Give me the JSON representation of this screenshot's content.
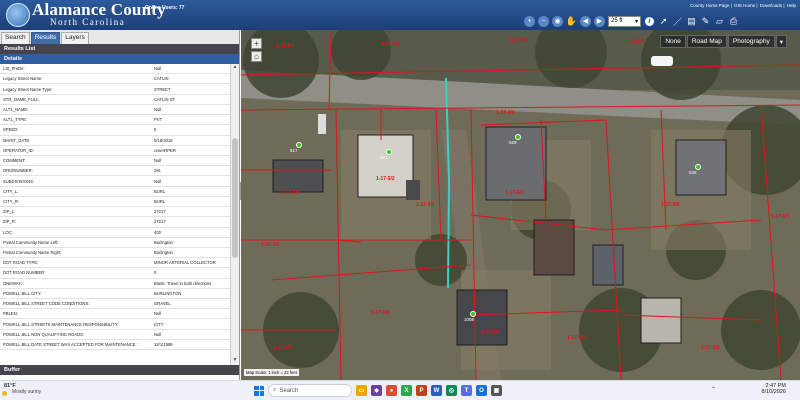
{
  "header": {
    "brand_line1": "Alamance County",
    "brand_line2": "North Carolina",
    "online_users": "Online Users: 77",
    "links": [
      "County Home Page",
      "GIS Home",
      "Downloads",
      "Help"
    ],
    "scale_value": "25 ft",
    "info_label": "i"
  },
  "sidebar": {
    "tabs": [
      "Search",
      "Results",
      "Layers"
    ],
    "active_tab": "Results",
    "results_list_label": "Results List",
    "details_label": "Details",
    "buffer_label": "Buffer",
    "rows": [
      {
        "key": "LSt_PreDir:",
        "value": "Null"
      },
      {
        "key": "Legacy Street Name:",
        "value": "CATLIN"
      },
      {
        "key": "Legacy Street Name Type:",
        "value": "STREET"
      },
      {
        "key": "STR_NAME_FULL:",
        "value": "CATLIN ST"
      },
      {
        "key": "ALT1_NAME:",
        "value": "Null"
      },
      {
        "key": "ALT1_TYPE:",
        "value": "PVT"
      },
      {
        "key": "SPEED:",
        "value": "0"
      },
      {
        "key": "MAINT_DATE:",
        "value": "5/18/2018"
      },
      {
        "key": "OPERATOR_ID:",
        "value": "cnwARPER"
      },
      {
        "key": "COMMENT:",
        "value": "Null"
      },
      {
        "key": "GRIDNUMBER:",
        "value": "291"
      },
      {
        "key": "SUBDIVISIONS:",
        "value": "Null"
      },
      {
        "key": "CITY_L:",
        "value": "BURL"
      },
      {
        "key": "CITY_R:",
        "value": "BURL"
      },
      {
        "key": "ZIP_L:",
        "value": "27217"
      },
      {
        "key": "ZIP_R:",
        "value": "27217"
      },
      {
        "key": "LOC:",
        "value": "400"
      },
      {
        "key": "Postal Community Name Left:",
        "value": "Burlington"
      },
      {
        "key": "Postal Community Name Right:",
        "value": "Burlington"
      },
      {
        "key": "DOT ROAD TYPE:",
        "value": "MINOR ARTERIAL COLLECTOR"
      },
      {
        "key": "DOT ROAD NUMBER:",
        "value": "0"
      },
      {
        "key": "ONEWAY:",
        "value": "Blank- Travel in both directions"
      },
      {
        "key": "POWELL BILL CITY:",
        "value": "BURLINGTON"
      },
      {
        "key": "POWELL BILL STREET CODE CONDITIONS:",
        "value": "GRAVEL"
      },
      {
        "key": "PBLEN:",
        "value": "Null"
      },
      {
        "key": "POWELL BILL STREETS MAINTENANCE RESPONSIBILITY:",
        "value": "CITY"
      },
      {
        "key": "POWELL BILL NON QUALIFYING ROADS:",
        "value": "Null"
      },
      {
        "key": "POWELL BILL DATE STREET WAS ACCEPTED FOR MAINTENANCE:",
        "value": "12/1/1988"
      }
    ]
  },
  "map": {
    "basemaps": [
      "None",
      "Road Map",
      "Photography"
    ],
    "scale_text": "Map Scale: 1 inch = 22 feet",
    "parcel_labels": [
      "1-17-8/7",
      "1-17-8/4",
      "1-17-8/1",
      "1-17-6/2",
      "1-17-5/2",
      "1-17-6/3",
      "1-17-8/5",
      "1-17-8/0",
      "1-17-6/1",
      "1-17-8/3",
      "1-17-4/2",
      "1-17-4/3",
      "1-17-6/8",
      "1-17-5/9",
      "1-17-4/5",
      "1-17-4/8",
      "1-17-4/1"
    ],
    "address_markers": [
      "517",
      "521",
      "529",
      "535",
      "1008"
    ]
  },
  "taskbar": {
    "weather_temp": "81°F",
    "weather_desc": "Mostly sunny",
    "search_placeholder": "Search",
    "time": "2:47 PM",
    "date": "8/10/2026"
  },
  "colors": {
    "header_blue": "#1d3f78",
    "parcel_line": "#e0141c",
    "active_tab": "#3f6ca8",
    "marker_green": "#35c51e"
  }
}
